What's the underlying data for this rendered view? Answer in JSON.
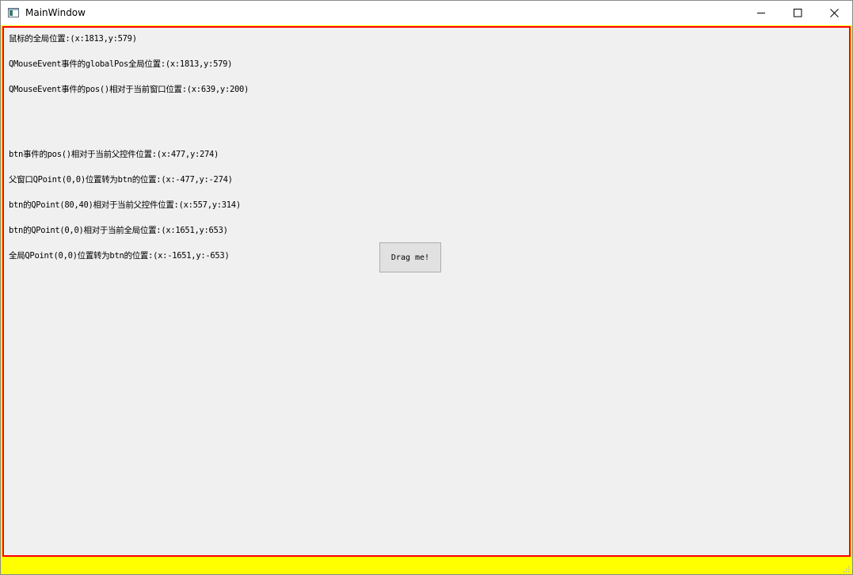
{
  "window": {
    "title": "MainWindow",
    "icon": "app-window-icon",
    "controls": [
      "minimize-icon",
      "maximize-icon",
      "close-icon"
    ]
  },
  "content": {
    "lines": [
      "鼠标的全局位置:(x:1813,y:579)",
      "QMouseEvent事件的globalPos全局位置:(x:1813,y:579)",
      "QMouseEvent事件的pos()相对于当前窗口位置:(x:639,y:200)",
      "btn事件的pos()相对于当前父控件位置:(x:477,y:274)",
      "父窗口QPoint(0,0)位置转为btn的位置:(x:-477,y:-274)",
      "btn的QPoint(80,40)相对于当前父控件位置:(x:557,y:314)",
      "btn的QPoint(0,0)相对于当前全局位置:(x:1651,y:653)",
      "全局QPoint(0,0)位置转为btn的位置:(x:-1651,y:-653)"
    ],
    "drag_button_label": "Drag me!"
  },
  "colors": {
    "content_border": "#ff0000",
    "window_background": "#ffff00",
    "content_background": "#f0f0f0"
  }
}
